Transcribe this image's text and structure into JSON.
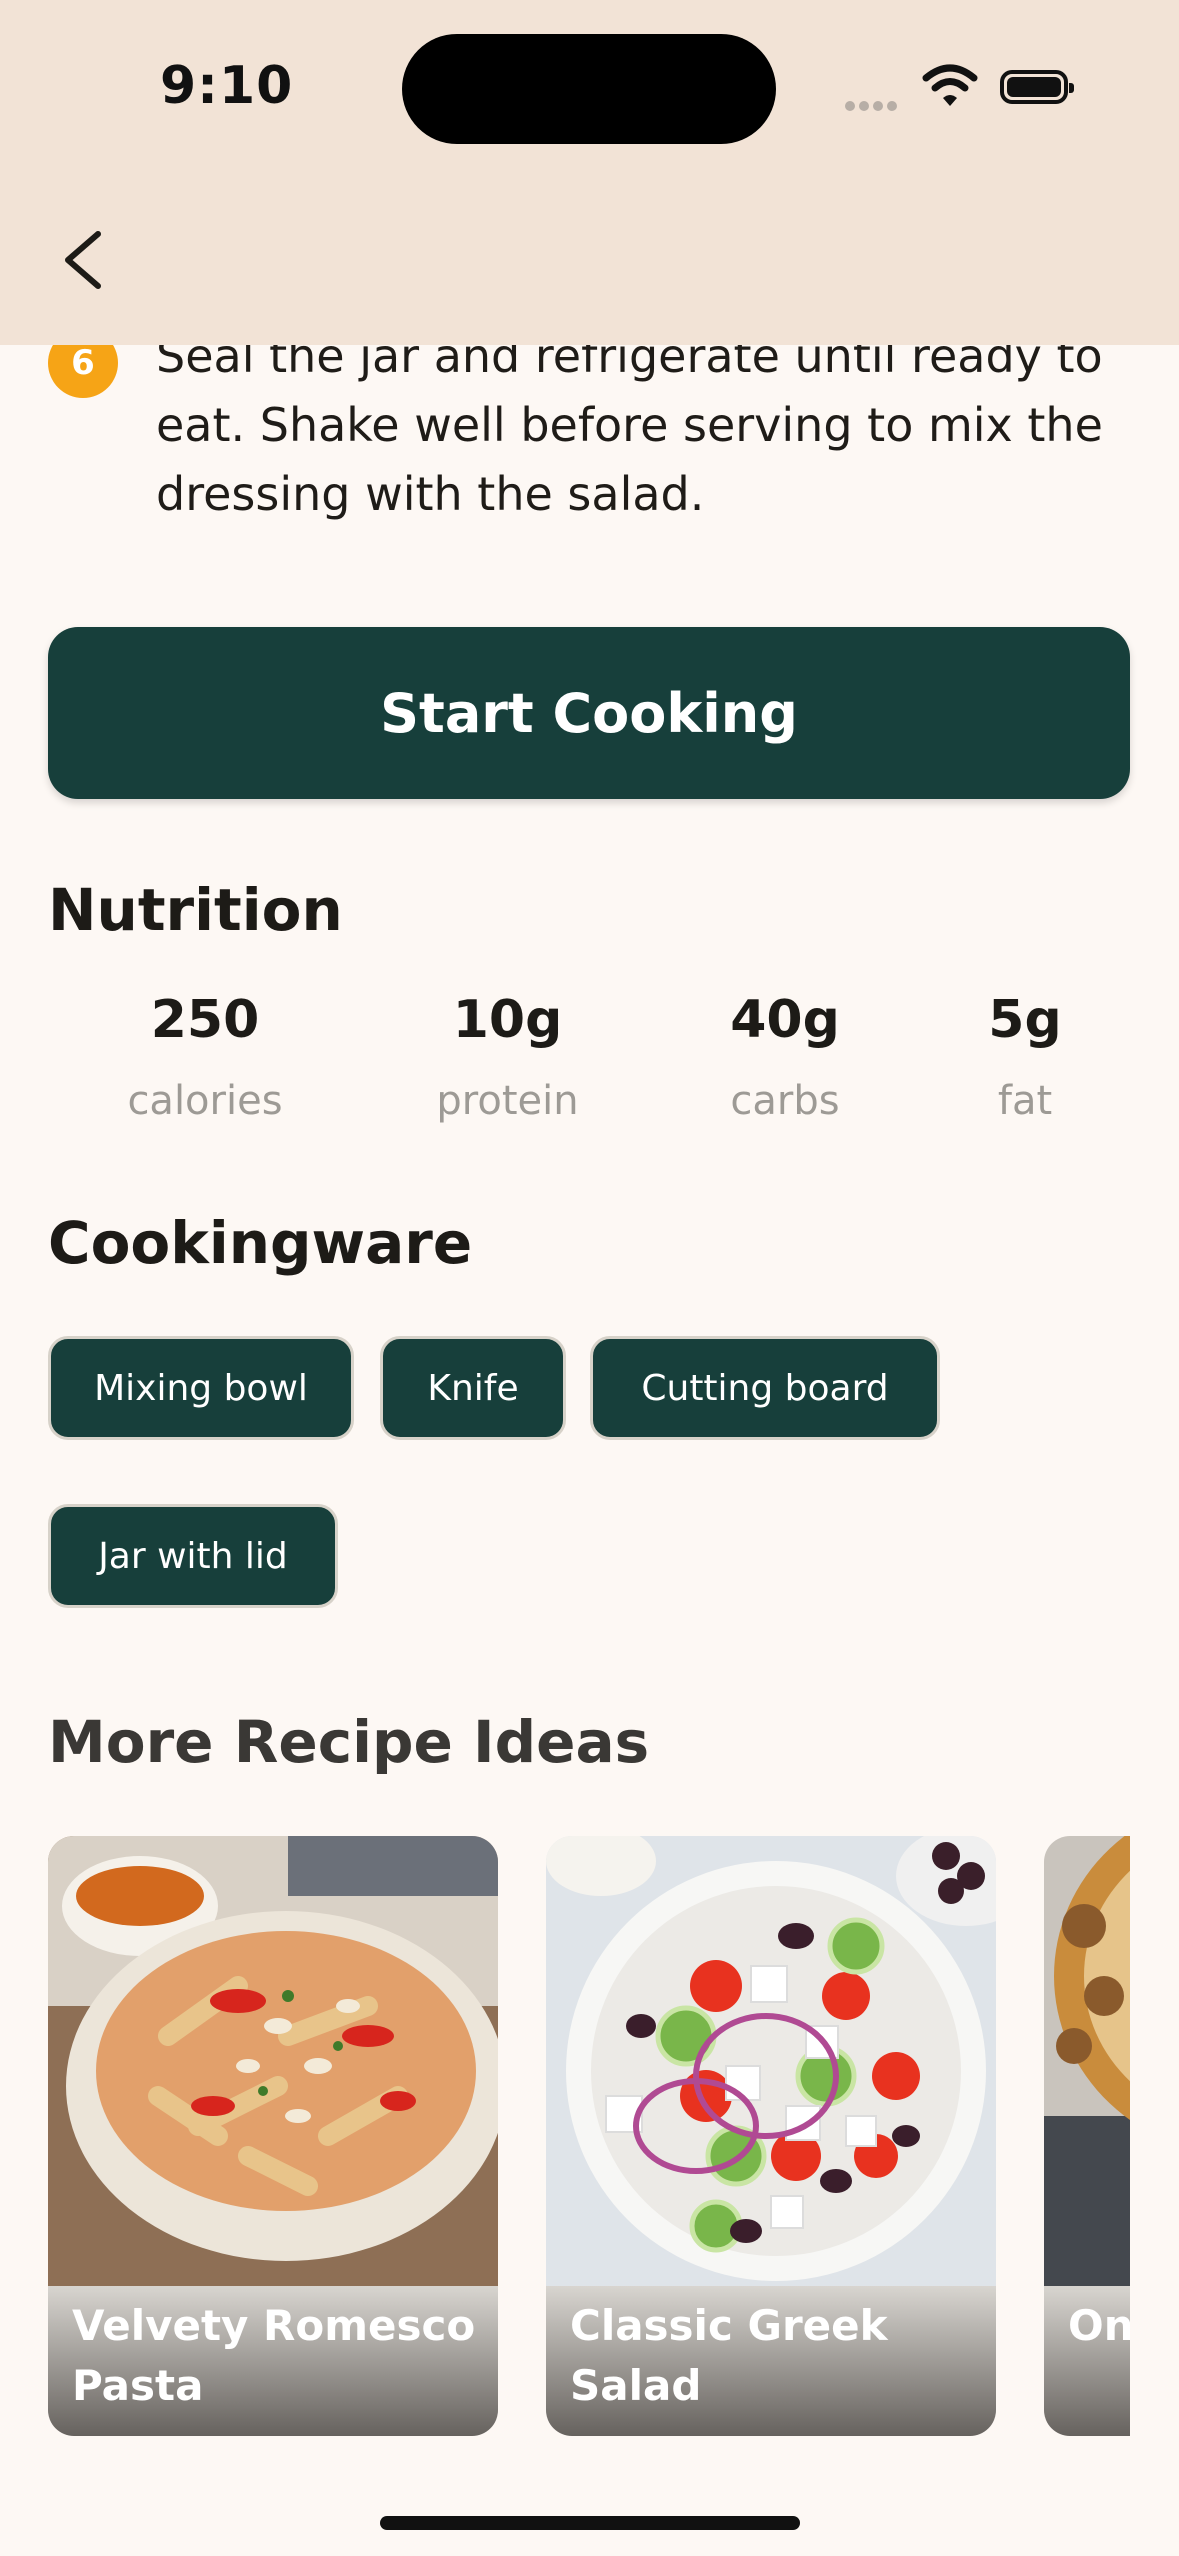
{
  "status": {
    "time": "9:10"
  },
  "step": {
    "number": "6",
    "text": "Seal the jar and refrigerate until ready to eat. Shake well before serving to mix the dressing with the salad."
  },
  "cta_label": "Start Cooking",
  "nutrition": {
    "title": "Nutrition",
    "items": [
      {
        "value": "250",
        "label": "calories"
      },
      {
        "value": "10g",
        "label": "protein"
      },
      {
        "value": "40g",
        "label": "carbs"
      },
      {
        "value": "5g",
        "label": "fat"
      }
    ]
  },
  "cookingware": {
    "title": "Cookingware",
    "items": [
      "Mixing bowl",
      "Knife",
      "Cutting board",
      "Jar with lid"
    ]
  },
  "more_ideas": {
    "title": "More Recipe Ideas",
    "cards": [
      {
        "title": "Velvety Romesco Pasta"
      },
      {
        "title": "Classic Greek Salad"
      },
      {
        "title": "On"
      }
    ]
  },
  "colors": {
    "primary": "#173f3b",
    "accent": "#f6a416",
    "header_bg": "#f2e3d6",
    "page_bg": "#fdf8f4"
  }
}
